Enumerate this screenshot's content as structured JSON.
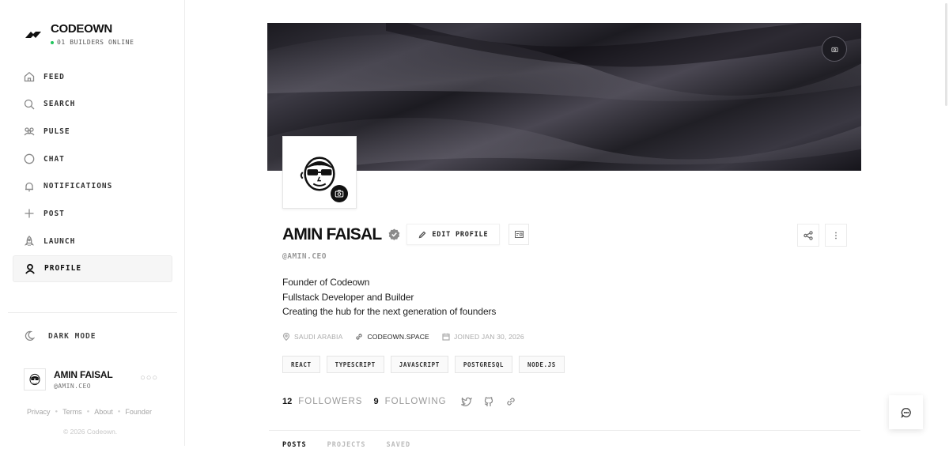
{
  "brand": {
    "name": "CODEOWN",
    "online": "01 BUILDERS ONLINE",
    "online_color": "#22c55e"
  },
  "sidebar": {
    "items": [
      {
        "label": "FEED",
        "icon": "home-icon"
      },
      {
        "label": "SEARCH",
        "icon": "search-icon"
      },
      {
        "label": "PULSE",
        "icon": "users-icon"
      },
      {
        "label": "CHAT",
        "icon": "chat-icon"
      },
      {
        "label": "NOTIFICATIONS",
        "icon": "bell-icon"
      },
      {
        "label": "POST",
        "icon": "plus-icon"
      },
      {
        "label": "LAUNCH",
        "icon": "rocket-icon"
      },
      {
        "label": "PROFILE",
        "icon": "user-icon",
        "active": true
      }
    ],
    "dark_mode": "DARK MODE",
    "user": {
      "name": "AMIN FAISAL",
      "handle": "@AMIN.CEO"
    },
    "footer_links": [
      "Privacy",
      "Terms",
      "About",
      "Founder"
    ],
    "copyright": "© 2026 Codeown."
  },
  "profile": {
    "name": "AMIN FAISAL",
    "handle": "@AMIN.CEO",
    "edit_label": "EDIT PROFILE",
    "bio": [
      "Founder of Codeown",
      "Fullstack Developer and Builder",
      "Creating the hub for the next generation of founders"
    ],
    "location": "SAUDI ARABIA",
    "website": "CODEOWN.SPACE",
    "joined": "JOINED JAN 30, 2026",
    "tags": [
      "REACT",
      "TYPESCRIPT",
      "JAVASCRIPT",
      "POSTGRESQL",
      "NODE.JS"
    ],
    "followers": {
      "count": "12",
      "label": "FOLLOWERS"
    },
    "following": {
      "count": "9",
      "label": "FOLLOWING"
    }
  },
  "tabs": [
    "POSTS",
    "PROJECTS",
    "SAVED"
  ]
}
